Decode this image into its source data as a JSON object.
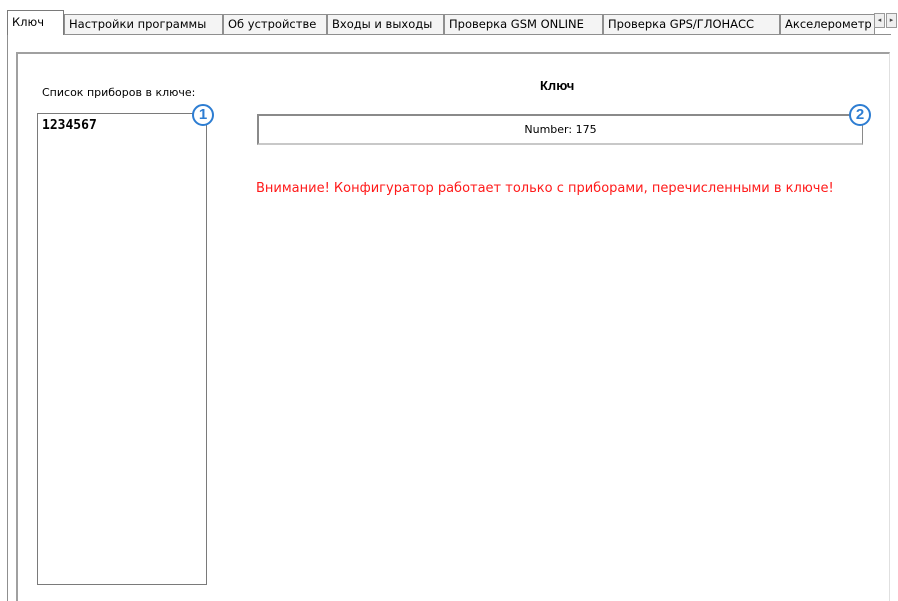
{
  "tabs": [
    {
      "label": "Ключ"
    },
    {
      "label": "Настройки программы"
    },
    {
      "label": "Об устройстве"
    },
    {
      "label": "Входы и выходы"
    },
    {
      "label": "Проверка GSM ONLINE"
    },
    {
      "label": "Проверка GPS/ГЛОНАСС"
    },
    {
      "label": "Акселерометр"
    }
  ],
  "tab_scroll": {
    "left": "◂",
    "right": "▸"
  },
  "key_panel": {
    "list_label": "Список приборов в ключе:",
    "devices": [
      "1234567"
    ],
    "title": "Ключ",
    "number_text": "Number: 175",
    "warning": "Внимание! Конфигуратор работает только с приборами, перечисленными в ключе!"
  },
  "callouts": {
    "one": "1",
    "two": "2"
  },
  "colors": {
    "warning": "#ff1a1a",
    "callout": "#2d7dd2"
  }
}
